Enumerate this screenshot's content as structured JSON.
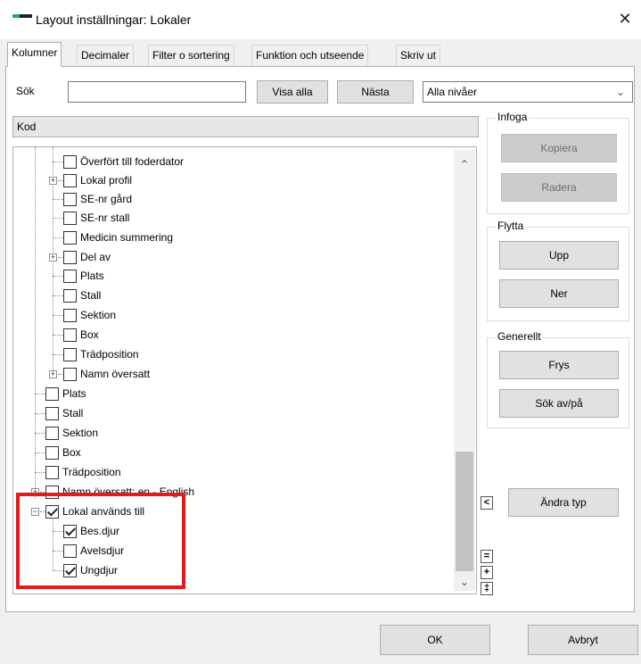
{
  "window": {
    "title": "Layout inställningar: Lokaler",
    "close_glyph": "✕"
  },
  "tabs": [
    {
      "label": "Kolumner",
      "active": true
    },
    {
      "label": "Decimaler"
    },
    {
      "label": "Filter o sortering"
    },
    {
      "label": "Funktion och utseende"
    },
    {
      "label": "Skriv ut"
    }
  ],
  "search": {
    "label": "Sök",
    "value": "",
    "show_all": "Visa alla",
    "next": "Nästa",
    "level_combo": "Alla nivåer"
  },
  "tree_header": "Kod",
  "tree": [
    {
      "label": "Överfört till foderdator",
      "checked": false
    },
    {
      "label": "Lokal profil",
      "checked": false
    },
    {
      "label": "SE-nr gård",
      "checked": false
    },
    {
      "label": "SE-nr stall",
      "checked": false
    },
    {
      "label": "Medicin summering",
      "checked": false
    },
    {
      "label": "Del av",
      "checked": false
    },
    {
      "label": "Plats",
      "checked": false
    },
    {
      "label": "Stall",
      "checked": false
    },
    {
      "label": "Sektion",
      "checked": false
    },
    {
      "label": "Box",
      "checked": false
    },
    {
      "label": "Trädposition",
      "checked": false
    },
    {
      "label": "Namn översatt",
      "checked": false
    },
    {
      "label": "Plats",
      "checked": false
    },
    {
      "label": "Stall",
      "checked": false
    },
    {
      "label": "Sektion",
      "checked": false
    },
    {
      "label": "Box",
      "checked": false
    },
    {
      "label": "Trädposition",
      "checked": false
    },
    {
      "label": "Namn översatt: en - English",
      "checked": false
    },
    {
      "label": "Lokal används till",
      "checked": true
    },
    {
      "label": "Bes.djur",
      "checked": true
    },
    {
      "label": "Avelsdjur",
      "checked": false
    },
    {
      "label": "Ungdjur",
      "checked": true
    }
  ],
  "infoga": {
    "title": "Infoga",
    "copy": "Kopiera",
    "delete": "Radera"
  },
  "flytta": {
    "title": "Flytta",
    "up": "Upp",
    "down": "Ner"
  },
  "generellt": {
    "title": "Generellt",
    "freeze": "Frys",
    "search_toggle": "Sök av/på"
  },
  "side": {
    "collapse_glyph": "<",
    "change_type": "Ändra typ",
    "minus": "=",
    "plus": "+",
    "updown": "‡"
  },
  "footer": {
    "ok": "OK",
    "cancel": "Avbryt"
  }
}
